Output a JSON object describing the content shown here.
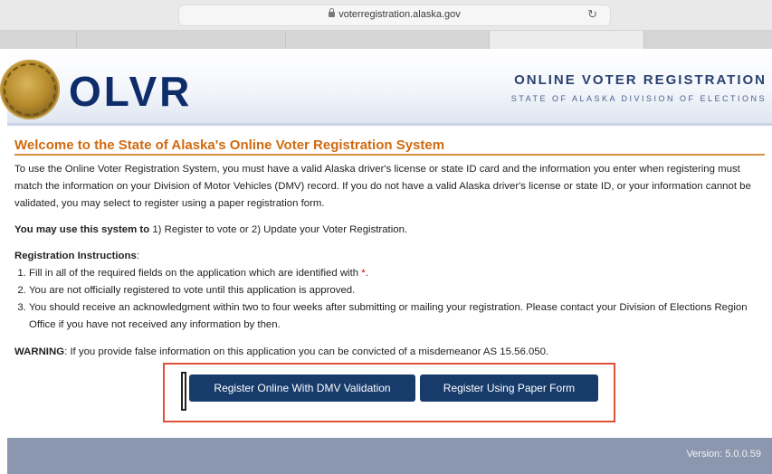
{
  "browser": {
    "url": "voterregistration.alaska.gov",
    "reload_icon": "↻"
  },
  "header": {
    "logo": "OLVR",
    "title": "ONLINE VOTER REGISTRATION",
    "subtitle": "STATE OF ALASKA DIVISION OF ELECTIONS"
  },
  "main": {
    "heading": "Welcome to the State of Alaska's Online Voter Registration System",
    "intro": "To use the Online Voter Registration System, you must have a valid Alaska driver's license or state ID card and the information you enter when registering must match the information on your Division of Motor Vehicles (DMV) record. If you do not have a valid Alaska driver's license or state ID, or your information cannot be validated, you may select to register using a paper registration form.",
    "use_label": "You may use this system to",
    "use_text": " 1) Register to vote or 2) Update your Voter Registration.",
    "instructions_label": "Registration Instructions",
    "instructions_colon": ":",
    "instructions": [
      "Fill in all of the required fields on the application which are identified with ",
      "You are not officially registered to vote until this application is approved.",
      "You should receive an acknowledgment within two to four weeks after submitting or mailing your registration.  Please contact your Division of Elections Region Office if you have not received any information by then."
    ],
    "required_marker": "*",
    "period": ".",
    "warning_label": "WARNING",
    "warning_text": ": If you provide false information on this application you can be convicted of a misdemeanor AS 15.56.050."
  },
  "buttons": {
    "dmv": "Register Online With DMV Validation",
    "paper": "Register Using Paper Form"
  },
  "footer": {
    "version": "Version: 5.0.0.59"
  },
  "colors": {
    "heading": "#d06a10",
    "button": "#173b6b",
    "highlight_box": "#e0503a",
    "footer": "#8a97ae"
  }
}
